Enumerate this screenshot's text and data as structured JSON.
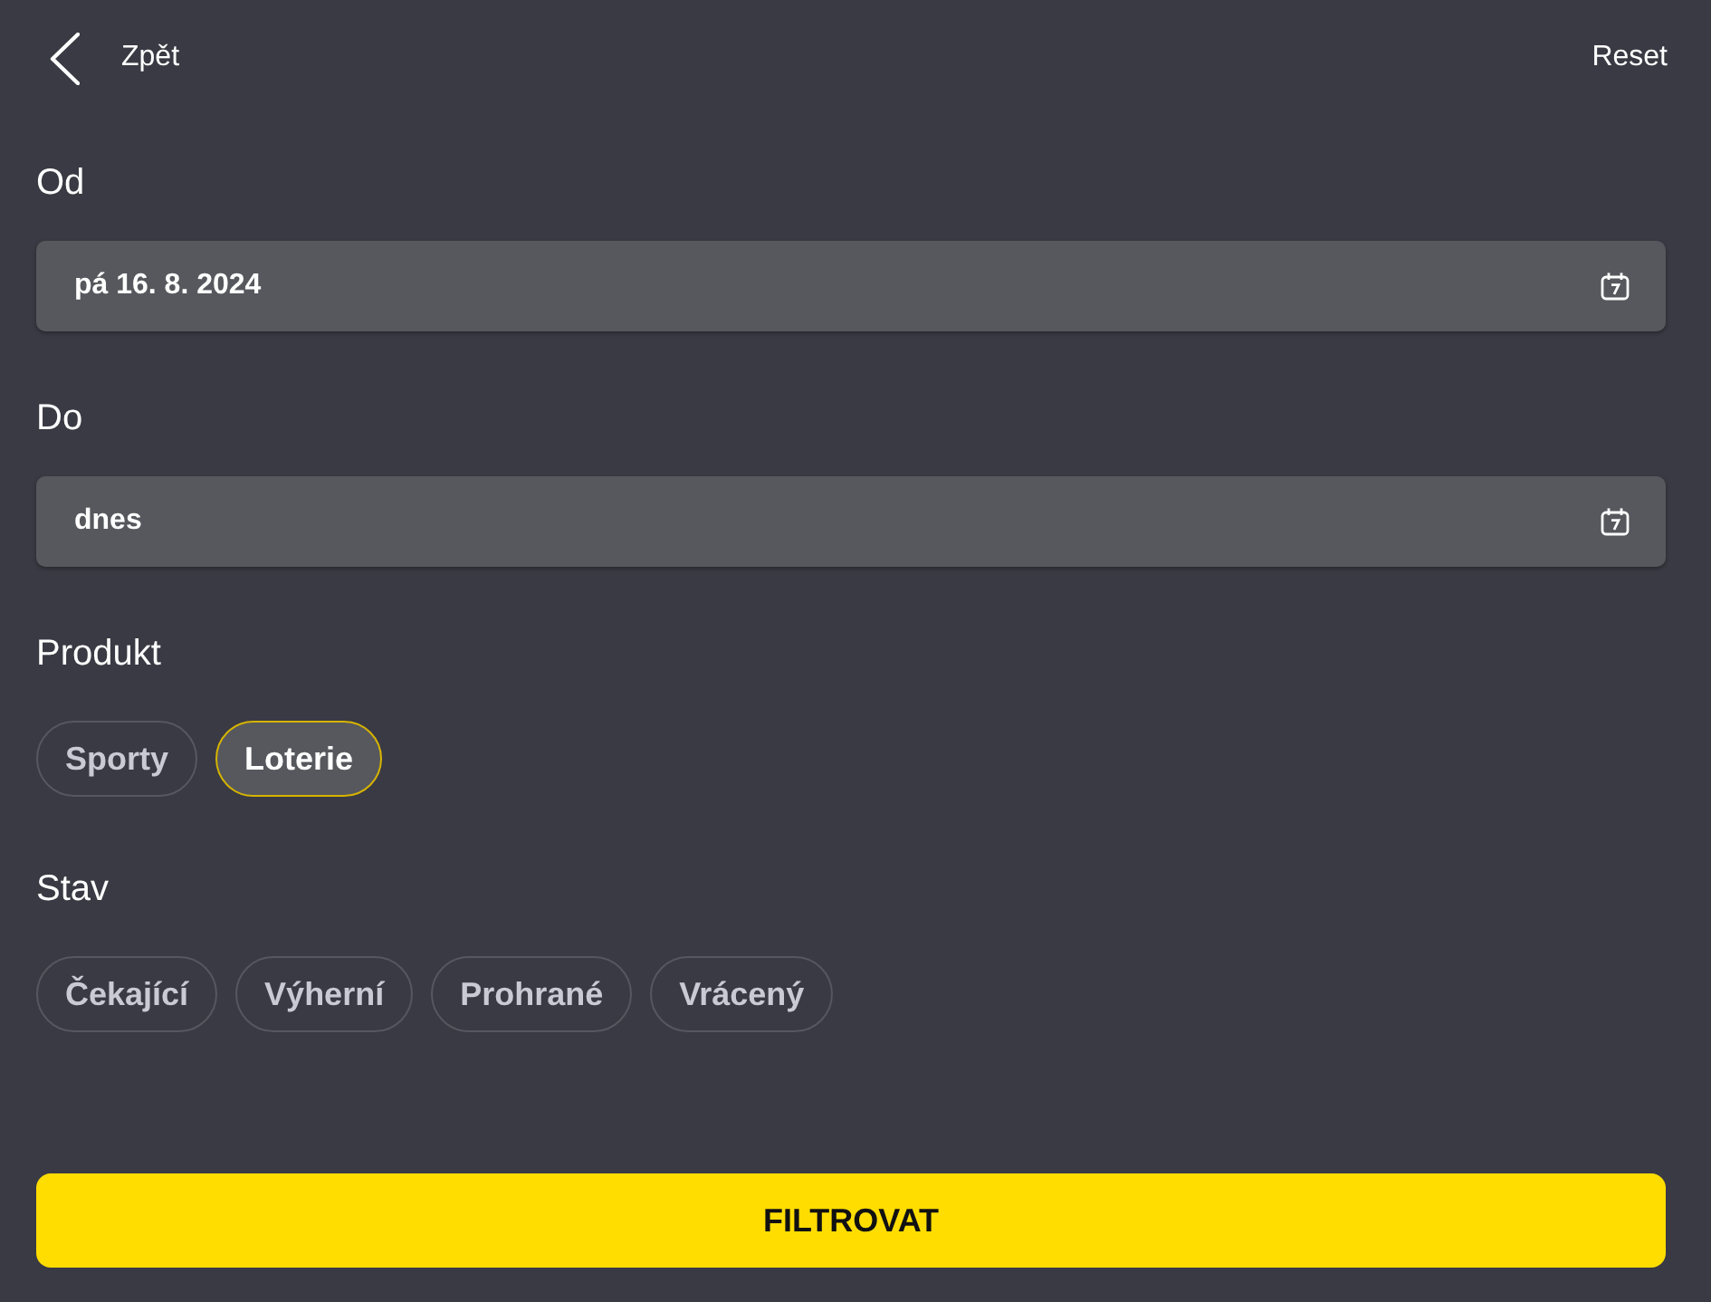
{
  "header": {
    "back_label": "Zpět",
    "reset_label": "Reset"
  },
  "filters": [
    {
      "kind": "date",
      "label": "Od",
      "value": "pá 16. 8. 2024"
    },
    {
      "kind": "date",
      "label": "Do",
      "value": "dnes"
    },
    {
      "kind": "chips",
      "label": "Produkt",
      "options": [
        {
          "label": "Sporty",
          "selected": false
        },
        {
          "label": "Loterie",
          "selected": true
        }
      ]
    },
    {
      "kind": "chips",
      "label": "Stav",
      "options": [
        {
          "label": "Čekající",
          "selected": false
        },
        {
          "label": "Výherní",
          "selected": false
        },
        {
          "label": "Prohrané",
          "selected": false
        },
        {
          "label": "Vrácený",
          "selected": false
        }
      ]
    }
  ],
  "submit": {
    "label": "FILTROVAT"
  }
}
